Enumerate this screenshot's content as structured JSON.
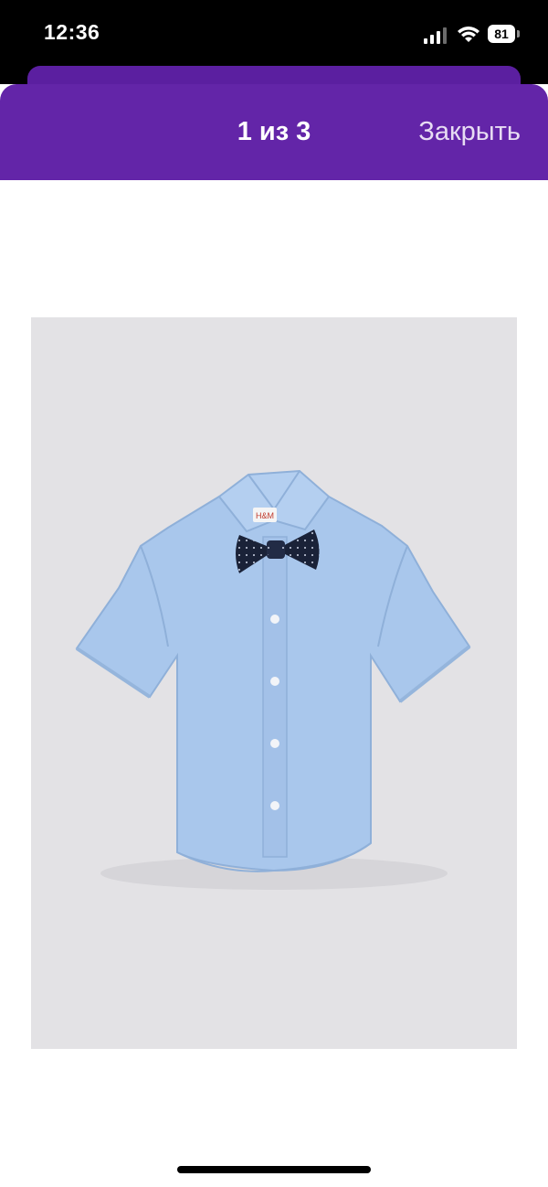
{
  "status_bar": {
    "time": "12:36",
    "battery_level": "81",
    "icons": [
      "signal-icon",
      "wifi-icon",
      "battery-icon"
    ]
  },
  "gallery_header": {
    "counter": "1 из 3",
    "close_label": "Закрыть",
    "background_color": "#6325a8"
  },
  "product_image": {
    "description_icon": "shirt-with-bow-tie-icon",
    "shirt_color": "#a9c7ec",
    "bow_tie_color": "#1a2238",
    "label_text": "H&M"
  }
}
